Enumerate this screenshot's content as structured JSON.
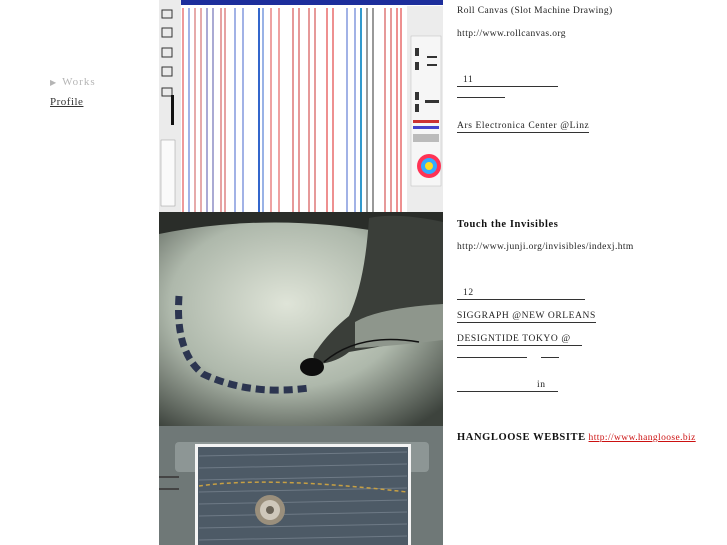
{
  "nav": {
    "works": "Works",
    "profile": "Profile"
  },
  "projects": [
    {
      "title": "Roll Canvas (Slot Machine Drawing)",
      "url": "http://www.rollcanvas.org",
      "lines": [
        "11",
        "",
        "Ars Electronica Center @Linz"
      ]
    },
    {
      "title": "Touch the Invisibles",
      "url": "http://www.junji.org/invisibles/indexj.htm",
      "lines": [
        "12",
        "SIGGRAPH @NEW ORLEANS",
        "DESIGNTIDE TOKYO @",
        "",
        "in"
      ]
    },
    {
      "title": "HANGLOOSE WEBSITE",
      "url": "http://www.hangloose.biz"
    }
  ],
  "colors": {
    "link": "#cc1111",
    "nav_inactive": "#b5b5b5"
  }
}
